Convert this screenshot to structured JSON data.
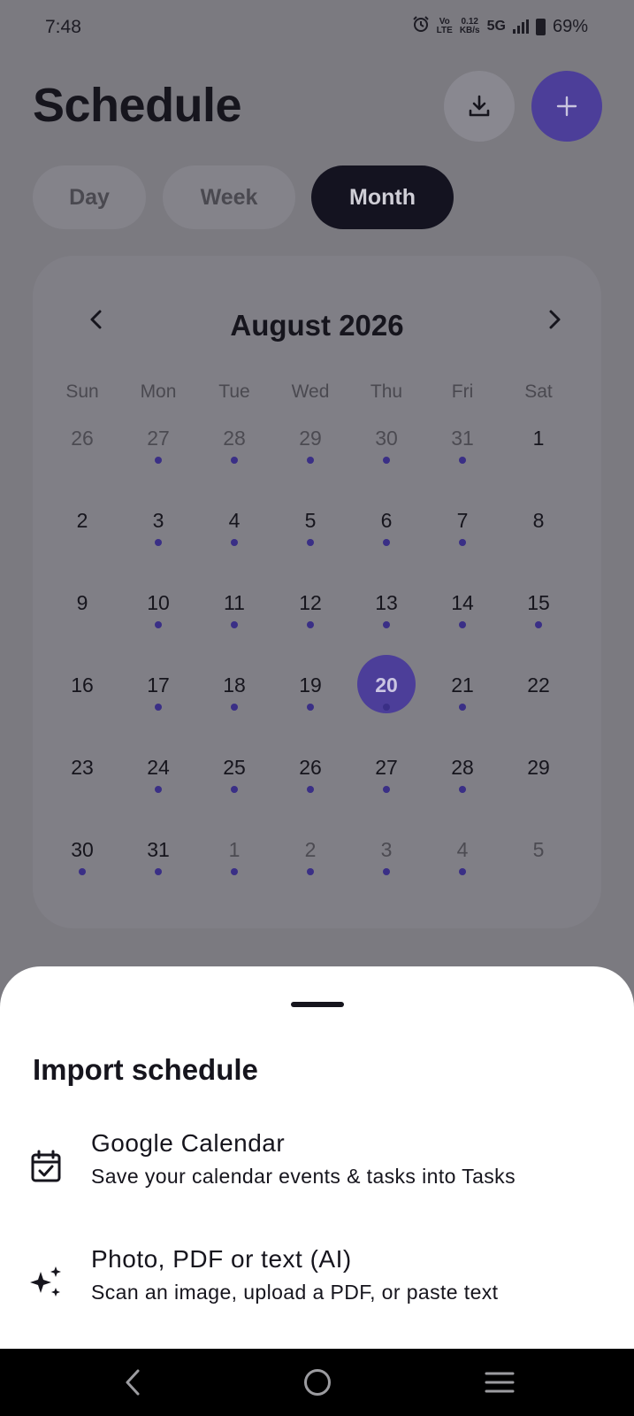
{
  "status_bar": {
    "time": "7:48",
    "volte_line1": "Vo",
    "volte_line2": "LTE",
    "speed_value": "0.12",
    "speed_unit": "KB/s",
    "network": "5G",
    "battery": "69%"
  },
  "header": {
    "title": "Schedule",
    "download_icon": "download-icon",
    "add_icon": "plus-icon"
  },
  "view_tabs": [
    {
      "label": "Day",
      "active": false
    },
    {
      "label": "Week",
      "active": false
    },
    {
      "label": "Month",
      "active": true
    }
  ],
  "calendar": {
    "month_label": "August 2026",
    "weekdays": [
      "Sun",
      "Mon",
      "Tue",
      "Wed",
      "Thu",
      "Fri",
      "Sat"
    ],
    "selected_day": "20",
    "weeks": [
      [
        {
          "d": "26",
          "o": true,
          "e": false
        },
        {
          "d": "27",
          "o": true,
          "e": true
        },
        {
          "d": "28",
          "o": true,
          "e": true
        },
        {
          "d": "29",
          "o": true,
          "e": true
        },
        {
          "d": "30",
          "o": true,
          "e": true
        },
        {
          "d": "31",
          "o": true,
          "e": true
        },
        {
          "d": "1",
          "o": false,
          "e": false
        }
      ],
      [
        {
          "d": "2",
          "o": false,
          "e": false
        },
        {
          "d": "3",
          "o": false,
          "e": true
        },
        {
          "d": "4",
          "o": false,
          "e": true
        },
        {
          "d": "5",
          "o": false,
          "e": true
        },
        {
          "d": "6",
          "o": false,
          "e": true
        },
        {
          "d": "7",
          "o": false,
          "e": true
        },
        {
          "d": "8",
          "o": false,
          "e": false
        }
      ],
      [
        {
          "d": "9",
          "o": false,
          "e": false
        },
        {
          "d": "10",
          "o": false,
          "e": true
        },
        {
          "d": "11",
          "o": false,
          "e": true
        },
        {
          "d": "12",
          "o": false,
          "e": true
        },
        {
          "d": "13",
          "o": false,
          "e": true
        },
        {
          "d": "14",
          "o": false,
          "e": true
        },
        {
          "d": "15",
          "o": false,
          "e": true
        }
      ],
      [
        {
          "d": "16",
          "o": false,
          "e": false
        },
        {
          "d": "17",
          "o": false,
          "e": true
        },
        {
          "d": "18",
          "o": false,
          "e": true
        },
        {
          "d": "19",
          "o": false,
          "e": true
        },
        {
          "d": "20",
          "o": false,
          "e": true
        },
        {
          "d": "21",
          "o": false,
          "e": true
        },
        {
          "d": "22",
          "o": false,
          "e": false
        }
      ],
      [
        {
          "d": "23",
          "o": false,
          "e": false
        },
        {
          "d": "24",
          "o": false,
          "e": true
        },
        {
          "d": "25",
          "o": false,
          "e": true
        },
        {
          "d": "26",
          "o": false,
          "e": true
        },
        {
          "d": "27",
          "o": false,
          "e": true
        },
        {
          "d": "28",
          "o": false,
          "e": true
        },
        {
          "d": "29",
          "o": false,
          "e": false
        }
      ],
      [
        {
          "d": "30",
          "o": false,
          "e": true
        },
        {
          "d": "31",
          "o": false,
          "e": true
        },
        {
          "d": "1",
          "o": true,
          "e": true
        },
        {
          "d": "2",
          "o": true,
          "e": true
        },
        {
          "d": "3",
          "o": true,
          "e": true
        },
        {
          "d": "4",
          "o": true,
          "e": true
        },
        {
          "d": "5",
          "o": true,
          "e": false
        }
      ]
    ]
  },
  "sheet": {
    "title": "Import schedule",
    "options": [
      {
        "icon": "calendar-check-icon",
        "title": "Google Calendar",
        "subtitle": "Save your calendar events & tasks into Tasks"
      },
      {
        "icon": "sparkles-icon",
        "title": "Photo, PDF or text (AI)",
        "subtitle": "Scan an image, upload a PDF, or paste text"
      }
    ]
  },
  "nav_bar": {
    "back_icon": "back-icon",
    "home_icon": "home-icon",
    "recents_icon": "recents-icon"
  },
  "colors": {
    "accent": "#5b4bc4",
    "scrim_background": "#7b7a80",
    "sheet_background": "#ffffff"
  }
}
